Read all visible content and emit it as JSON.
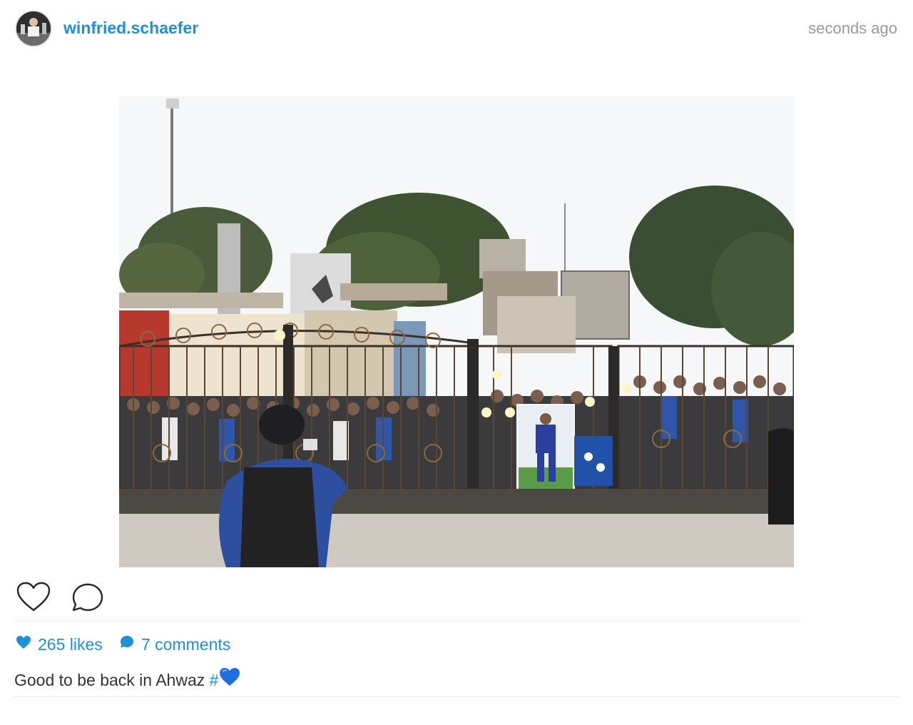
{
  "post": {
    "username": "winfried.schaefer",
    "timestamp": "seconds ago",
    "avatar_icon": "user-avatar",
    "photo_description_icon": "post-photo"
  },
  "actions": {
    "like_icon": "heart-outline-icon",
    "comment_icon": "speech-bubble-icon"
  },
  "stats": {
    "likes_text": "265 likes",
    "comments_text": "7 comments",
    "likes_icon": "heart-filled-icon",
    "comments_icon": "speech-bubble-filled-icon"
  },
  "caption": {
    "text": "Good to be back in Ahwaz ",
    "hashtag": "#",
    "emoji": "blue-heart-emoji"
  },
  "colors": {
    "link_blue": "#1e90d8",
    "timestamp_grey": "#9a9a9a",
    "divider": "#efefef"
  }
}
